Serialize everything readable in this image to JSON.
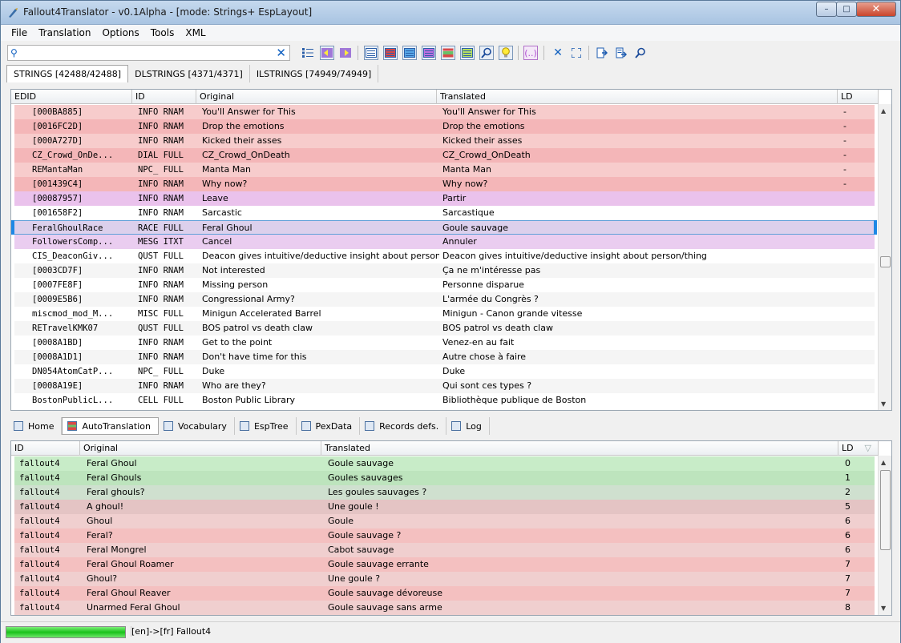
{
  "window": {
    "title": "Fallout4Translator - v0.1Alpha - [mode: Strings+ EspLayout]",
    "min": "–",
    "max": "□",
    "close": "✕"
  },
  "menu": [
    "File",
    "Translation",
    "Options",
    "Tools",
    "XML"
  ],
  "search": {
    "value": "",
    "clear": "✕"
  },
  "tabs_top": [
    "STRINGS [42488/42488]",
    "DLSTRINGS [4371/4371]",
    "ILSTRINGS [74949/74949]"
  ],
  "grid_top": {
    "columns": [
      "EDID",
      "ID",
      "Original",
      "Translated",
      "LD"
    ],
    "rows": [
      {
        "edid": "[000BA885]",
        "id": "INFO RNAM",
        "orig": "You'll Answer for This",
        "trans": "You'll Answer for This",
        "ld": "-",
        "color": "#f7cccc"
      },
      {
        "edid": "[0016FC2D]",
        "id": "INFO RNAM",
        "orig": "Drop the emotions",
        "trans": "Drop the emotions",
        "ld": "-",
        "color": "#f4b6b8"
      },
      {
        "edid": "[000A727D]",
        "id": "INFO RNAM",
        "orig": "Kicked their asses",
        "trans": "Kicked their asses",
        "ld": "-",
        "color": "#f7cccc"
      },
      {
        "edid": "CZ_Crowd_OnDe...",
        "id": "DIAL FULL",
        "orig": "CZ_Crowd_OnDeath",
        "trans": "CZ_Crowd_OnDeath",
        "ld": "-",
        "color": "#f4b6b8"
      },
      {
        "edid": "REMantaMan",
        "id": "NPC_ FULL",
        "orig": "Manta Man",
        "trans": "Manta Man",
        "ld": "-",
        "color": "#f7cccc"
      },
      {
        "edid": "[001439C4]",
        "id": "INFO RNAM",
        "orig": "Why now?",
        "trans": "Why now?",
        "ld": "-",
        "color": "#f4b6b8"
      },
      {
        "edid": "[00087957]",
        "id": "INFO RNAM",
        "orig": "Leave",
        "trans": "Partir",
        "ld": "",
        "color": "#eac2ec"
      },
      {
        "edid": "[001658F2]",
        "id": "INFO RNAM",
        "orig": "Sarcastic",
        "trans": "Sarcastique",
        "ld": "",
        "color": "#ffffff"
      },
      {
        "edid": "FeralGhoulRace",
        "id": "RACE FULL",
        "orig": "Feral Ghoul",
        "trans": "Goule sauvage",
        "ld": "",
        "color": "#dcd0ec"
      },
      {
        "edid": "FollowersComp...",
        "id": "MESG ITXT",
        "orig": "Cancel",
        "trans": "Annuler",
        "ld": "",
        "color": "#eacdf0"
      },
      {
        "edid": "CIS_DeaconGiv...",
        "id": "QUST FULL",
        "orig": "Deacon gives intuitive/deductive insight about person/th...",
        "trans": "Deacon gives intuitive/deductive insight about person/thing",
        "ld": "",
        "color": "#ffffff"
      },
      {
        "edid": "[0003CD7F]",
        "id": "INFO RNAM",
        "orig": "Not interested",
        "trans": "Ça ne m'intéresse pas",
        "ld": "",
        "color": "#f5f5f5"
      },
      {
        "edid": "[0007FE8F]",
        "id": "INFO RNAM",
        "orig": "Missing person",
        "trans": "Personne disparue",
        "ld": "",
        "color": "#ffffff"
      },
      {
        "edid": "[0009E5B6]",
        "id": "INFO RNAM",
        "orig": "Congressional Army?",
        "trans": "L'armée du Congrès ?",
        "ld": "",
        "color": "#f5f5f5"
      },
      {
        "edid": "miscmod_mod_M...",
        "id": "MISC FULL",
        "orig": "Minigun Accelerated Barrel",
        "trans": "Minigun - Canon grande vitesse",
        "ld": "",
        "color": "#ffffff"
      },
      {
        "edid": "RETravelKMK07",
        "id": "QUST FULL",
        "orig": "BOS patrol vs death claw",
        "trans": "BOS patrol vs death claw",
        "ld": "",
        "color": "#f5f5f5"
      },
      {
        "edid": "[0008A1BD]",
        "id": "INFO RNAM",
        "orig": "Get to the point",
        "trans": "Venez-en au fait",
        "ld": "",
        "color": "#ffffff"
      },
      {
        "edid": "[0008A1D1]",
        "id": "INFO RNAM",
        "orig": "Don't have time for this",
        "trans": "Autre chose à faire",
        "ld": "",
        "color": "#f5f5f5"
      },
      {
        "edid": "DN054AtomCatP...",
        "id": "NPC_ FULL",
        "orig": "Duke",
        "trans": "Duke",
        "ld": "",
        "color": "#ffffff"
      },
      {
        "edid": "[0008A19E]",
        "id": "INFO RNAM",
        "orig": "Who are they?",
        "trans": "Qui sont ces types ?",
        "ld": "",
        "color": "#f5f5f5"
      },
      {
        "edid": "BostonPublicL...",
        "id": "CELL FULL",
        "orig": "Boston Public Library",
        "trans": "Bibliothèque publique de Boston",
        "ld": "",
        "color": "#ffffff"
      }
    ]
  },
  "tabs_bottom": [
    "Home",
    "AutoTranslation",
    "Vocabulary",
    "EspTree",
    "PexData",
    "Records defs.",
    "Log"
  ],
  "grid_bottom": {
    "columns": [
      "ID",
      "Original",
      "Translated",
      "LD"
    ],
    "rows": [
      {
        "id": "fallout4",
        "orig": "Feral Ghoul",
        "trans": "Goule sauvage",
        "ld": "0",
        "color": "#c8ecc8"
      },
      {
        "id": "fallout4",
        "orig": "Feral Ghouls",
        "trans": "Goules sauvages",
        "ld": "1",
        "color": "#bde4bd"
      },
      {
        "id": "fallout4",
        "orig": "Feral ghouls?",
        "trans": "Les goules sauvages ?",
        "ld": "2",
        "color": "#cfe0cf"
      },
      {
        "id": "fallout4",
        "orig": "A ghoul!",
        "trans": "Une goule !",
        "ld": "5",
        "color": "#e4c4c4"
      },
      {
        "id": "fallout4",
        "orig": "Ghoul",
        "trans": "Goule",
        "ld": "6",
        "color": "#f0cfcf"
      },
      {
        "id": "fallout4",
        "orig": "Feral?",
        "trans": "Goule sauvage ?",
        "ld": "6",
        "color": "#f4c0c0"
      },
      {
        "id": "fallout4",
        "orig": "Feral Mongrel",
        "trans": "Cabot sauvage",
        "ld": "6",
        "color": "#f0cfcf"
      },
      {
        "id": "fallout4",
        "orig": "Feral Ghoul Roamer",
        "trans": "Goule sauvage errante",
        "ld": "7",
        "color": "#f4c0c0"
      },
      {
        "id": "fallout4",
        "orig": "Ghoul?",
        "trans": "Une goule ?",
        "ld": "7",
        "color": "#f0cfcf"
      },
      {
        "id": "fallout4",
        "orig": "Feral Ghoul Reaver",
        "trans": "Goule sauvage dévoreuse",
        "ld": "7",
        "color": "#f4c0c0"
      },
      {
        "id": "fallout4",
        "orig": "Unarmed Feral Ghoul",
        "trans": "Goule sauvage sans arme",
        "ld": "8",
        "color": "#f0cfcf"
      }
    ]
  },
  "status": {
    "progress": 1.0,
    "text": "[en]->[fr] Fallout4"
  }
}
